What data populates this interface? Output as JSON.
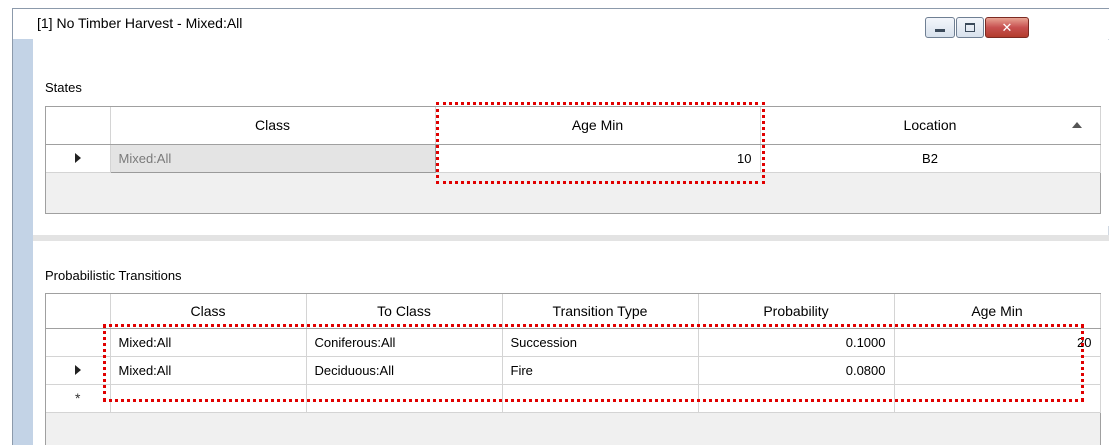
{
  "window": {
    "title": "[1] No Timber Harvest - Mixed:All",
    "minimize_label": "",
    "maximize_label": "",
    "close_label": "✕"
  },
  "states": {
    "section_label": "States",
    "columns": [
      "Class",
      "Age Min",
      "Location"
    ],
    "rows": [
      {
        "class": "Mixed:All",
        "age_min": "10",
        "location": "B2"
      }
    ]
  },
  "transitions": {
    "section_label": "Probabilistic Transitions",
    "columns": [
      "Class",
      "To Class",
      "Transition Type",
      "Probability",
      "Age Min"
    ],
    "rows": [
      {
        "class": "Mixed:All",
        "to_class": "Coniferous:All",
        "transition_type": "Succession",
        "probability": "0.1000",
        "age_min": "20"
      },
      {
        "class": "Mixed:All",
        "to_class": "Deciduous:All",
        "transition_type": "Fire",
        "probability": "0.0800",
        "age_min": ""
      }
    ],
    "new_row_marker": "*"
  },
  "colors": {
    "highlight": "#e00000",
    "window_border": "#8c9aab",
    "close_button": "#c75050"
  }
}
